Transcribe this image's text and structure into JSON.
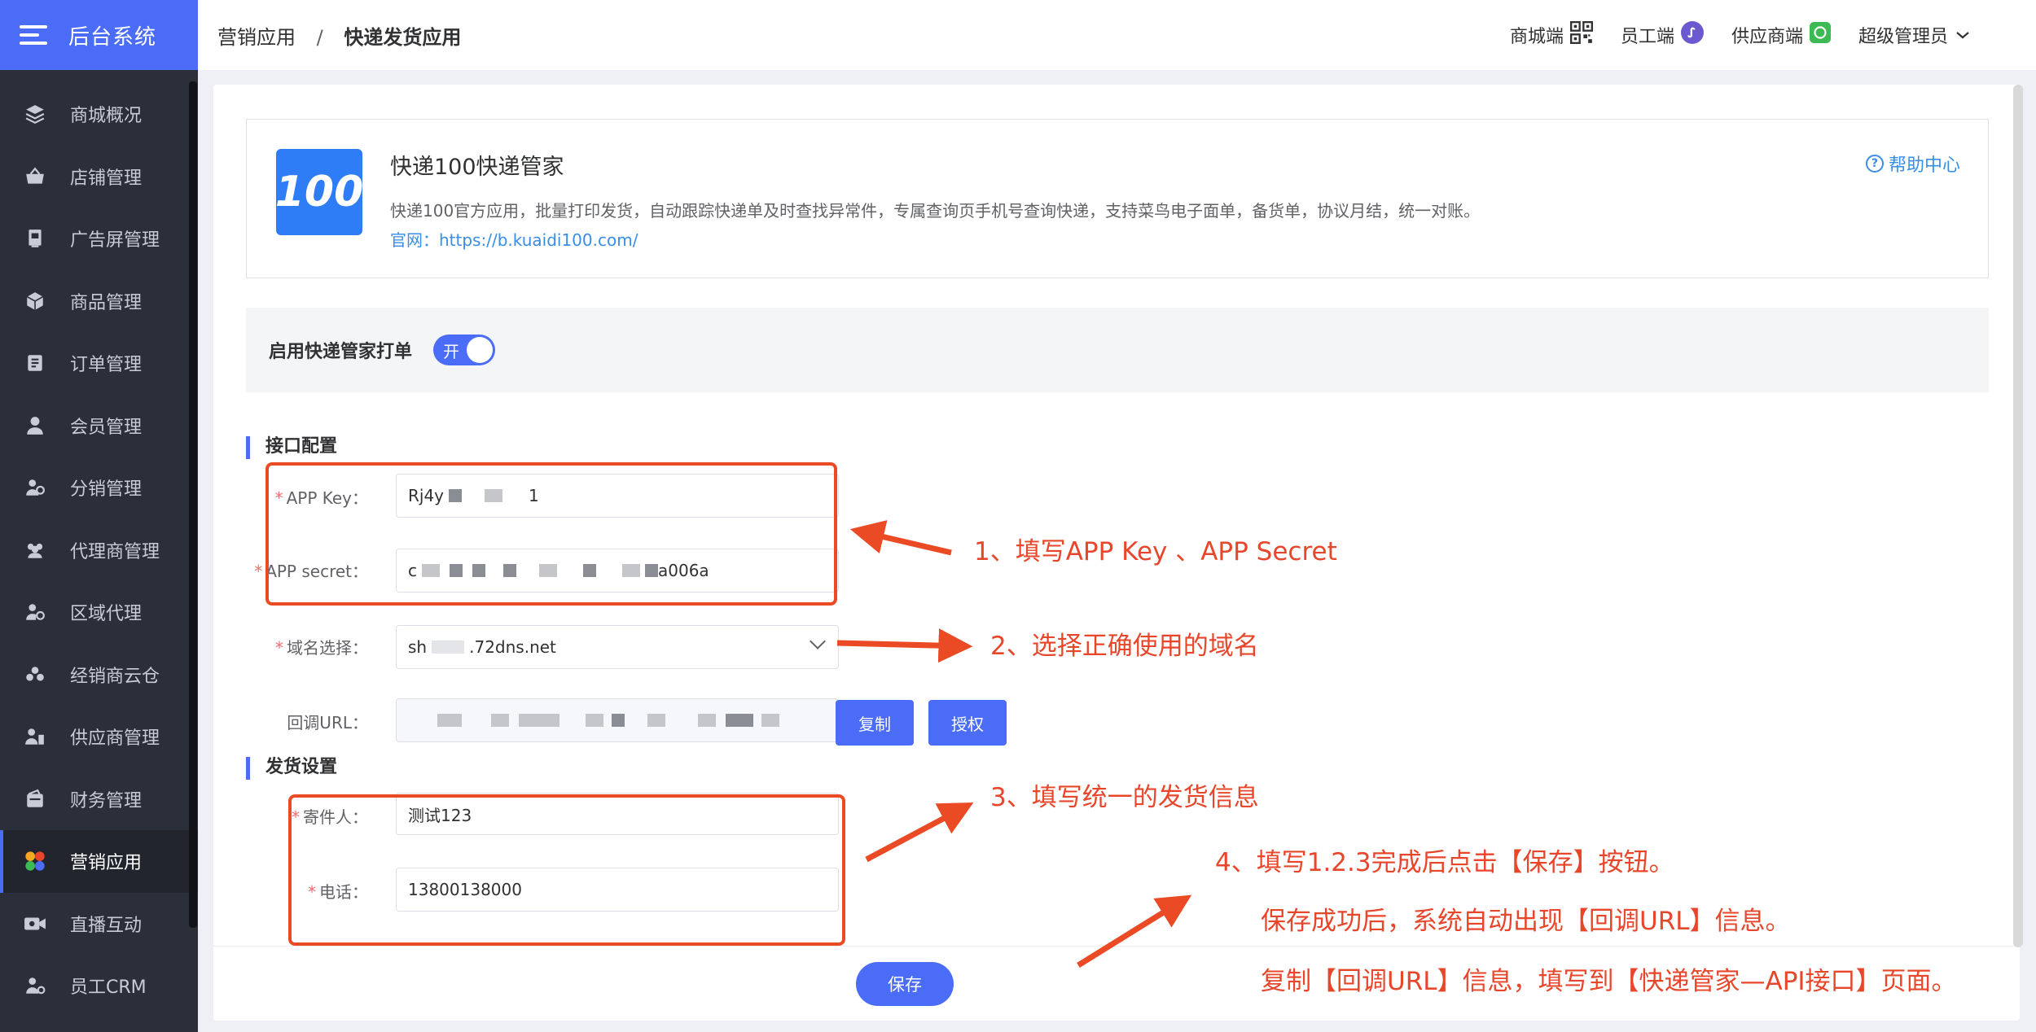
{
  "brand": {
    "title": "后台系统"
  },
  "sidebar": {
    "items": [
      {
        "label": "商城概况",
        "icon": "layers-icon",
        "active": false
      },
      {
        "label": "店铺管理",
        "icon": "basket-icon",
        "active": false
      },
      {
        "label": "广告屏管理",
        "icon": "screen-icon",
        "active": false
      },
      {
        "label": "商品管理",
        "icon": "box-icon",
        "active": false
      },
      {
        "label": "订单管理",
        "icon": "order-icon",
        "active": false
      },
      {
        "label": "会员管理",
        "icon": "user-icon",
        "active": false
      },
      {
        "label": "分销管理",
        "icon": "distribution-icon",
        "active": false
      },
      {
        "label": "代理商管理",
        "icon": "agent-icon",
        "active": false
      },
      {
        "label": "区域代理",
        "icon": "region-icon",
        "active": false
      },
      {
        "label": "经销商云仓",
        "icon": "cloud-warehouse-icon",
        "active": false
      },
      {
        "label": "供应商管理",
        "icon": "supplier-icon",
        "active": false
      },
      {
        "label": "财务管理",
        "icon": "wallet-icon",
        "active": false
      },
      {
        "label": "营销应用",
        "icon": "apps-icon",
        "active": true
      },
      {
        "label": "直播互动",
        "icon": "video-icon",
        "active": false
      },
      {
        "label": "员工CRM",
        "icon": "crm-icon",
        "active": false
      }
    ]
  },
  "header": {
    "breadcrumb": {
      "parent": "营销应用",
      "separator": "/",
      "current": "快递发货应用"
    },
    "links": {
      "mall": "商城端",
      "staff": "员工端",
      "supplier": "供应商端",
      "admin": "超级管理员"
    }
  },
  "app": {
    "logo_text": "100",
    "title": "快递100快递管家",
    "description": "快递100官方应用，批量打印发货，自动跟踪快递单及时查找异常件，专属查询页手机号查询快递，支持菜鸟电子面单，备货单，协议月结，统一对账。",
    "site": "官网：https://b.kuaidi100.com/",
    "help": "帮助中心"
  },
  "enable": {
    "label": "启用快递管家打单",
    "switch_text": "开"
  },
  "api_section": {
    "title": "接口配置",
    "app_key_label": "APP Key：",
    "app_key_value_start": "Rj4y",
    "app_key_value_end": "1",
    "app_secret_label": "APP secret：",
    "app_secret_value_start": "c",
    "app_secret_value_end": "a006a",
    "domain_label": "域名选择：",
    "domain_value_start": "sh",
    "domain_value_end": ".72dns.net",
    "callback_label": "回调URL：",
    "copy_button": "复制",
    "auth_button": "授权"
  },
  "ship_section": {
    "title": "发货设置",
    "sender_label": "寄件人：",
    "sender_value": "测试123",
    "phone_label": "电话：",
    "phone_value": "13800138000"
  },
  "footer": {
    "save": "保存"
  },
  "annotations": {
    "step1": "1、填写APP Key 、APP Secret",
    "step2": "2、选择正确使用的域名",
    "step3": "3、填写统一的发货信息",
    "step4": "4、填写1.2.3完成后点击【保存】按钮。",
    "step4_line2": "保存成功后，系统自动出现【回调URL】信息。",
    "step4_line3": "复制【回调URL】信息，填写到【快递管家—API接口】页面。"
  },
  "colors": {
    "primary": "#4a6cf7",
    "annotation": "#ea4a24",
    "sidebar_bg": "#2b2f3a"
  }
}
